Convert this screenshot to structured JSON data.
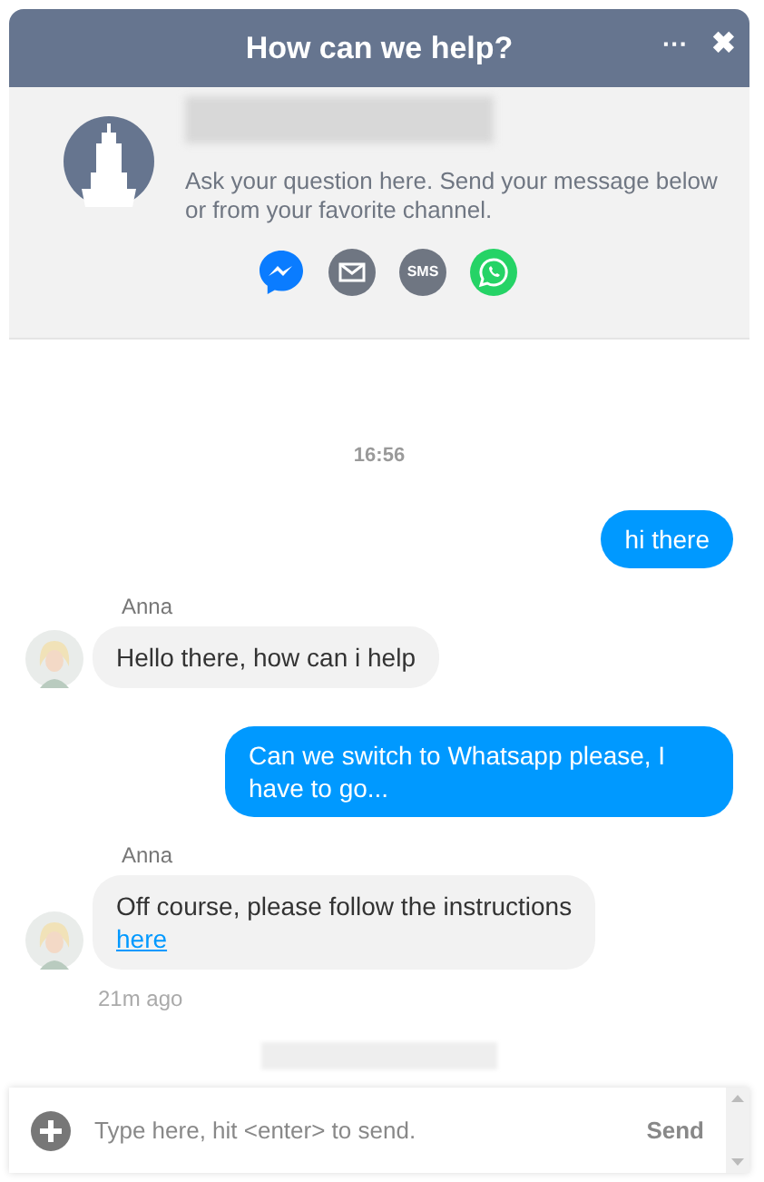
{
  "header": {
    "title": "How can we help?",
    "menu_label": "···",
    "close_label": "✖"
  },
  "intro": {
    "text": "Ask your question here. Send your message below or from your favorite channel.",
    "channels": [
      {
        "kind": "messenger"
      },
      {
        "kind": "email"
      },
      {
        "kind": "sms",
        "label": "SMS"
      },
      {
        "kind": "whatsapp"
      }
    ]
  },
  "chat": {
    "timestamp": "16:56",
    "messages": [
      {
        "kind": "user",
        "text": "hi there"
      },
      {
        "kind": "agent",
        "sender": "Anna",
        "text": "Hello there, how can i help"
      },
      {
        "kind": "user",
        "text": "Can we switch to Whatsapp please, I have to go..."
      },
      {
        "kind": "agent",
        "sender": "Anna",
        "text": "Off course, please follow the instructions",
        "link": "here",
        "time": "21m ago"
      }
    ]
  },
  "composer": {
    "placeholder": "Type here, hit <enter> to send.",
    "send_label": "Send"
  }
}
